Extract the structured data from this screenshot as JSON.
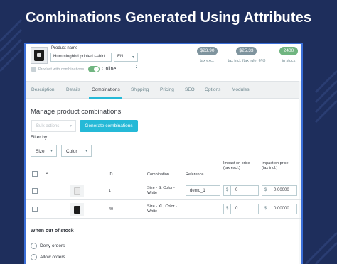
{
  "banner": {
    "title": "Combinations Generated Using Attributes"
  },
  "colors": {
    "background": "#1e2e5c",
    "accent": "#25b9d7",
    "frame_border": "#3b6fd8",
    "price_pill": "#7f949e",
    "stock_pill": "#70b580",
    "toggle_on": "#70b580"
  },
  "product": {
    "name_label": "Product name",
    "name_value": "Hummingbird printed t-shirt",
    "language": "EN",
    "combinations_caption": "Product with combinations",
    "status_label": "Online",
    "status_on": true
  },
  "summary": {
    "price_excl": "$23.90",
    "price_excl_caption": "tax excl.",
    "price_incl": "$25.33",
    "price_incl_caption": "tax incl. (tax rule: 6%)",
    "stock": "2400",
    "stock_caption": "in stock"
  },
  "tabs": [
    {
      "label": "Description",
      "active": false
    },
    {
      "label": "Details",
      "active": false
    },
    {
      "label": "Combinations",
      "active": true
    },
    {
      "label": "Shipping",
      "active": false
    },
    {
      "label": "Pricing",
      "active": false
    },
    {
      "label": "SEO",
      "active": false
    },
    {
      "label": "Options",
      "active": false
    },
    {
      "label": "Modules",
      "active": false
    }
  ],
  "combinations": {
    "title": "Manage product combinations",
    "bulk_actions": "Bulk actions",
    "generate_button": "Generate combinations",
    "filter_label": "Filter by:",
    "filters": [
      "Size",
      "Color"
    ],
    "columns": {
      "id": "ID",
      "combination": "Combination",
      "reference": "Reference",
      "impact_excl": "Impact on price (tax excl.)",
      "impact_incl": "Impact on price (tax incl.)"
    },
    "rows": [
      {
        "id": "1",
        "combination": "Size - S, Color - White",
        "reference": "demo_1",
        "impact_excl": "0",
        "impact_incl": "0.00000",
        "currency": "$",
        "image": "white-tshirt-thumbnail"
      },
      {
        "id": "40",
        "combination": "Size - XL, Color - White",
        "reference": "",
        "impact_excl": "0",
        "impact_incl": "0.00000",
        "currency": "$",
        "image": "black-tshirt-thumbnail"
      }
    ]
  },
  "out_of_stock": {
    "title": "When out of stock",
    "options": [
      "Deny orders",
      "Allow orders"
    ]
  }
}
